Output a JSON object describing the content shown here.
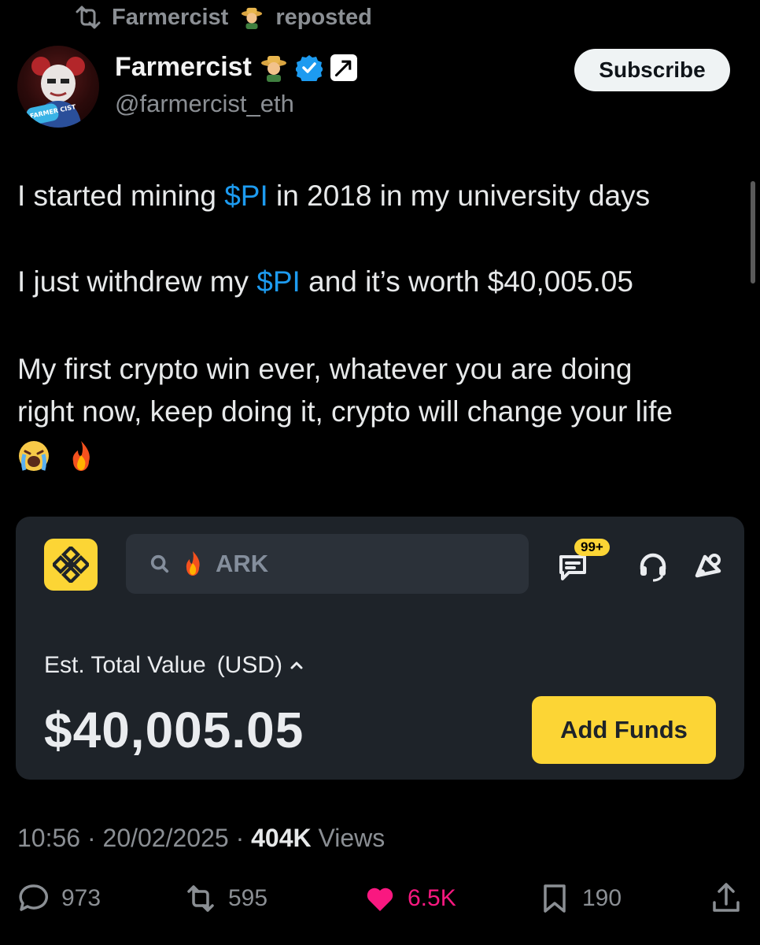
{
  "repost_header": {
    "name": "Farmercist",
    "suffix": "reposted"
  },
  "author": {
    "name": "Farmercist",
    "handle": "@farmercist_eth",
    "avatar_caption": "FARMER CIST"
  },
  "subscribe_label": "Subscribe",
  "tweet": {
    "line1_prefix": "I started mining ",
    "cashtag": "$PI",
    "line1_suffix": " in 2018 in my university days",
    "line2_prefix": "I just withdrew my ",
    "line2_suffix": " and it’s worth $40,005.05",
    "line3": "My first crypto win ever, whatever you are doing",
    "line4": "right now, keep doing it, crypto will change your life",
    "emojis": [
      "crying-face",
      "fire"
    ]
  },
  "binance_card": {
    "search_text": "ARK",
    "notification_badge": "99+",
    "est_label": "Est. Total Value",
    "currency": "(USD)",
    "total_value": "$40,005.05",
    "add_funds_label": "Add Funds",
    "colors": {
      "card_bg": "#1e2329",
      "accent": "#fcd535"
    }
  },
  "meta": {
    "time": "10:56",
    "date": "20/02/2025",
    "views_count": "404K",
    "views_label": "Views"
  },
  "actions": {
    "replies": "973",
    "reposts": "595",
    "likes": "6.5K",
    "bookmarks": "190"
  },
  "colors": {
    "link": "#1d9bf0",
    "like": "#f91880",
    "muted": "#8b8f94"
  }
}
